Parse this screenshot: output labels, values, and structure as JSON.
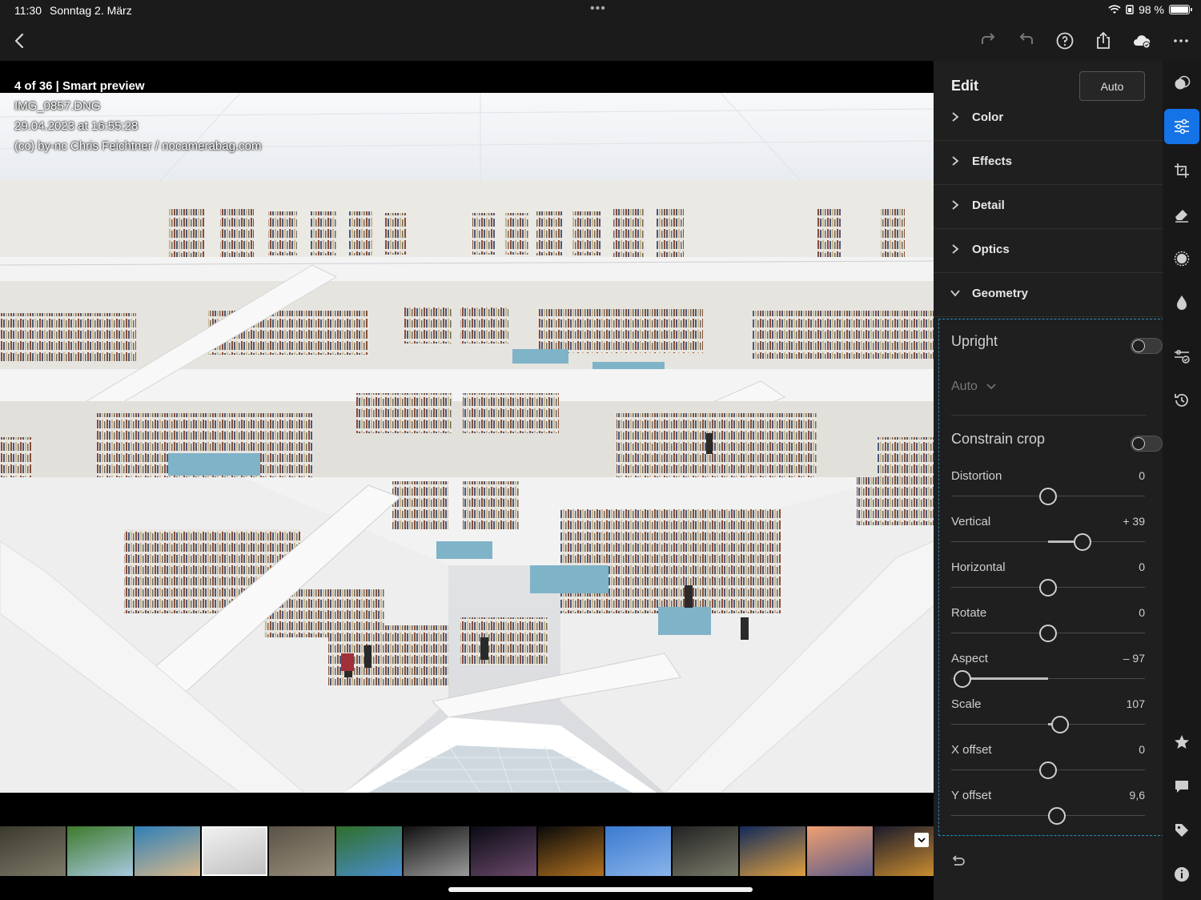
{
  "status": {
    "time": "11:30",
    "date": "Sonntag 2. März",
    "battery": "98 %",
    "battery_level": 0.98,
    "dots": "•••"
  },
  "toolbar": {
    "icons": [
      "back-icon",
      "redo-icon",
      "undo-icon",
      "help-icon",
      "share-icon",
      "cloud-sync-icon",
      "more-icon"
    ]
  },
  "photo": {
    "info_line1": "4 of 36 | Smart preview",
    "filename": "IMG_0857.DNG",
    "datetime": "29.04.2023 at 16:55:28",
    "credit": "(cc) by-nc Chris Feichtner / nocamerabag.com"
  },
  "filmstrip": {
    "thumbs": [
      {
        "c1": "#3b3a2e",
        "c2": "#7d7a68"
      },
      {
        "c1": "#3d7a2c",
        "c2": "#a8c9e0"
      },
      {
        "c1": "#2f7fb8",
        "c2": "#d9b98a"
      },
      {
        "c1": "#f2f2f2",
        "c2": "#bfbfbf"
      },
      {
        "c1": "#5a5246",
        "c2": "#9a8f7c"
      },
      {
        "c1": "#2f6e2a",
        "c2": "#4a8fd0"
      },
      {
        "c1": "#111111",
        "c2": "#9a9a9a"
      },
      {
        "c1": "#0a0a14",
        "c2": "#6a4a6a"
      },
      {
        "c1": "#0a0a0a",
        "c2": "#b07020"
      },
      {
        "c1": "#3a7ad0",
        "c2": "#8ab4ea"
      },
      {
        "c1": "#222222",
        "c2": "#7a7a6a"
      },
      {
        "c1": "#122a5a",
        "c2": "#e0a040"
      },
      {
        "c1": "#f0a070",
        "c2": "#5a5a8a"
      },
      {
        "c1": "#1a1a2a",
        "c2": "#d09030"
      }
    ],
    "selected_index": 3
  },
  "edit": {
    "title": "Edit",
    "auto_label": "Auto",
    "sections": [
      {
        "label": "Color",
        "expanded": false
      },
      {
        "label": "Effects",
        "expanded": false
      },
      {
        "label": "Detail",
        "expanded": false
      },
      {
        "label": "Optics",
        "expanded": false
      },
      {
        "label": "Geometry",
        "expanded": true
      }
    ],
    "geometry": {
      "upright_label": "Upright",
      "upright_on": false,
      "upright_mode": "Auto",
      "constrain_label": "Constrain crop",
      "constrain_on": false,
      "sliders": [
        {
          "label": "Distortion",
          "value": "0",
          "num": 0,
          "min": -100,
          "max": 100
        },
        {
          "label": "Vertical",
          "value": "+ 39",
          "num": 39,
          "min": -100,
          "max": 100
        },
        {
          "label": "Horizontal",
          "value": "0",
          "num": 0,
          "min": -100,
          "max": 100
        },
        {
          "label": "Rotate",
          "value": "0",
          "num": 0,
          "min": -10,
          "max": 10
        },
        {
          "label": "Aspect",
          "value": "– 97",
          "num": -97,
          "min": -100,
          "max": 100
        },
        {
          "label": "Scale",
          "value": "107",
          "num": 107,
          "min": 50,
          "max": 150
        },
        {
          "label": "X offset",
          "value": "0",
          "num": 0,
          "min": -100,
          "max": 100
        },
        {
          "label": "Y offset",
          "value": "9,6",
          "num": 9.6,
          "min": -100,
          "max": 100
        }
      ]
    }
  },
  "rail": {
    "items": [
      "presets-icon",
      "adjust-icon",
      "crop-icon",
      "heal-icon",
      "masking-icon",
      "blur-icon",
      "versions-icon",
      "history-icon",
      "star-icon",
      "comment-icon",
      "tag-icon",
      "info-icon"
    ],
    "active": "adjust-icon"
  },
  "colors": {
    "accent": "#1473e6",
    "highlight_border": "#2a89b8"
  }
}
